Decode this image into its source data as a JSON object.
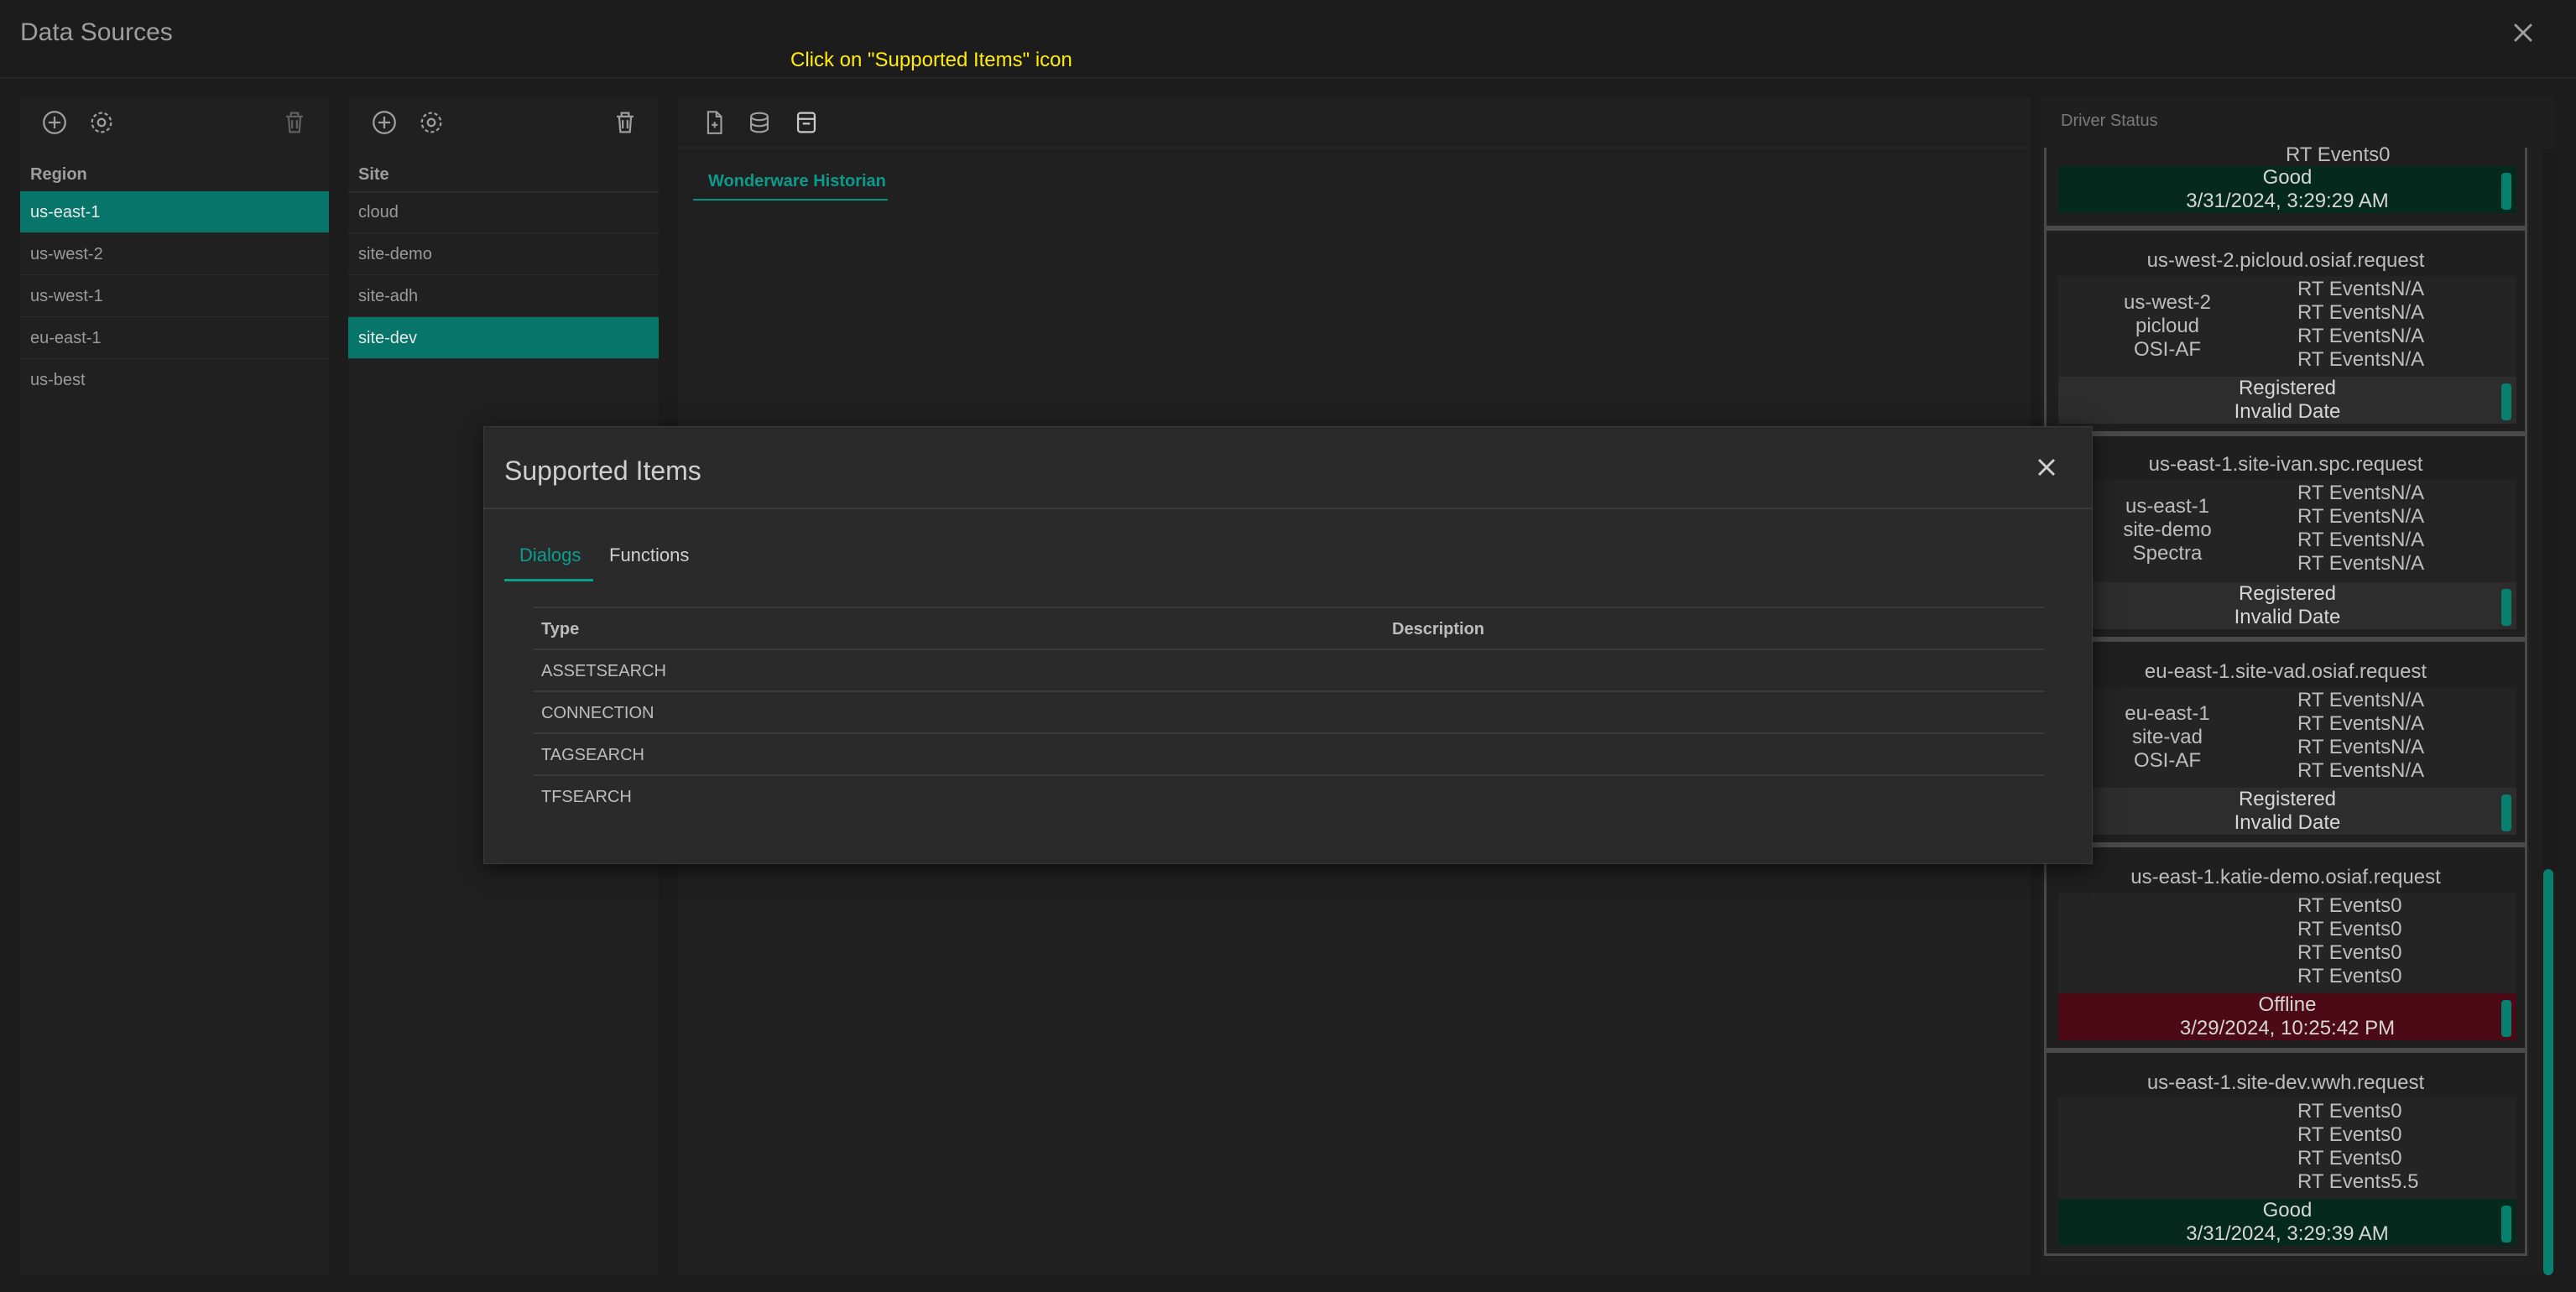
{
  "window": {
    "title": "Data Sources",
    "close_icon": "close-icon"
  },
  "annotation": {
    "text": "Click on \"Supported Items\" icon",
    "color": "#ffec0a",
    "box_color": "#e51b1b"
  },
  "region": {
    "header": "Region",
    "items": [
      "us-east-1",
      "us-west-2",
      "us-west-1",
      "eu-east-1",
      "us-best"
    ],
    "selected": "us-east-1"
  },
  "site": {
    "header": "Site",
    "items": [
      "cloud",
      "site-demo",
      "site-adh",
      "site-dev"
    ],
    "selected": "site-dev"
  },
  "sources": {
    "tab": "Wonderware Historian"
  },
  "driver_status": {
    "title": "Driver Status",
    "partial_top": {
      "rt": "RT Events0",
      "state": "Good",
      "time": "3/31/2024, 3:29:29 AM"
    },
    "cards": [
      {
        "name": "us-west-2.picloud.osiaf.request",
        "meta": [
          "us-west-2",
          "picloud",
          "OSI-AF"
        ],
        "rt": [
          "RT EventsN/A",
          "RT EventsN/A",
          "RT EventsN/A",
          "RT EventsN/A"
        ],
        "state": "Registered",
        "time": "Invalid Date"
      },
      {
        "name": "us-east-1.site-ivan.spc.request",
        "meta": [
          "us-east-1",
          "site-demo",
          "Spectra"
        ],
        "rt": [
          "RT EventsN/A",
          "RT EventsN/A",
          "RT EventsN/A",
          "RT EventsN/A"
        ],
        "state": "Registered",
        "time": "Invalid Date"
      },
      {
        "name": "eu-east-1.site-vad.osiaf.request",
        "meta": [
          "eu-east-1",
          "site-vad",
          "OSI-AF"
        ],
        "rt": [
          "RT EventsN/A",
          "RT EventsN/A",
          "RT EventsN/A",
          "RT EventsN/A"
        ],
        "state": "Registered",
        "time": "Invalid Date"
      },
      {
        "name": "us-east-1.katie-demo.osiaf.request",
        "meta": [],
        "rt": [
          "RT Events0",
          "RT Events0",
          "RT Events0",
          "RT Events0"
        ],
        "state": "Offline",
        "time": "3/29/2024, 10:25:42 PM"
      },
      {
        "name": "us-east-1.site-dev.wwh.request",
        "meta": [],
        "rt": [
          "RT Events0",
          "RT Events0",
          "RT Events0",
          "RT Events5.5"
        ],
        "state": "Good",
        "time": "3/31/2024, 3:29:39 AM"
      }
    ]
  },
  "modal": {
    "title": "Supported Items",
    "tabs": [
      "Dialogs",
      "Functions"
    ],
    "active_tab": "Dialogs",
    "columns": [
      "Type",
      "Description"
    ],
    "rows": [
      {
        "type": "ASSETSEARCH",
        "description": ""
      },
      {
        "type": "CONNECTION",
        "description": ""
      },
      {
        "type": "TAGSEARCH",
        "description": ""
      },
      {
        "type": "TFSEARCH",
        "description": ""
      }
    ]
  },
  "colors": {
    "accent": "#07756a",
    "good": "#05291d",
    "offline": "#4b0a16",
    "annotation": "#ffec0a"
  }
}
